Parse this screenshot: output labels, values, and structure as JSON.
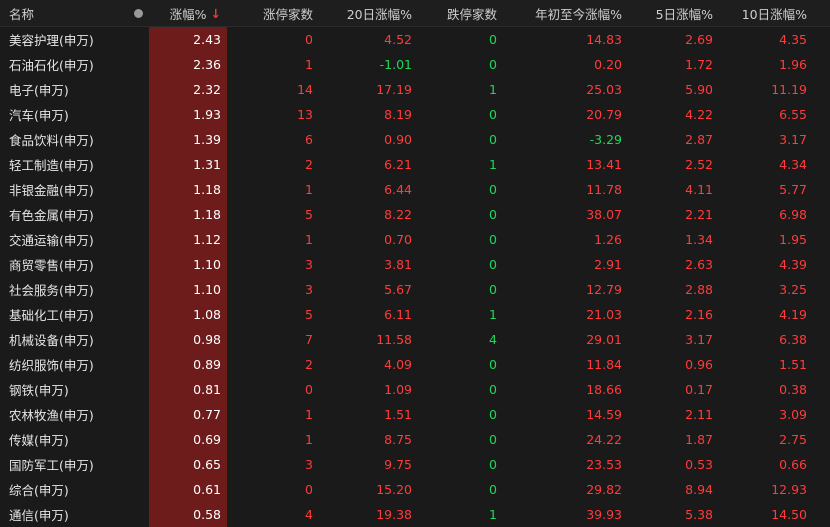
{
  "header": {
    "name": "名称",
    "change": "涨幅%",
    "sort_arrow": "↓",
    "limit_up": "涨停家数",
    "d20": "20日涨幅%",
    "limit_down": "跌停家数",
    "ytd": "年初至今涨幅%",
    "d5": "5日涨幅%",
    "d10": "10日涨幅%"
  },
  "colors": {
    "up": "#ff3b3b",
    "down": "#1ed75a",
    "highlight": "#6e1b1b",
    "background": "#1a1a1a"
  },
  "rows": [
    {
      "name": "美容护理(申万)",
      "change": "2.43",
      "limit_up": "0",
      "d20": "4.52",
      "limit_down": "0",
      "ytd": "14.83",
      "d5": "2.69",
      "d10": "4.35"
    },
    {
      "name": "石油石化(申万)",
      "change": "2.36",
      "limit_up": "1",
      "d20": "-1.01",
      "limit_down": "0",
      "ytd": "0.20",
      "d5": "1.72",
      "d10": "1.96"
    },
    {
      "name": "电子(申万)",
      "change": "2.32",
      "limit_up": "14",
      "d20": "17.19",
      "limit_down": "1",
      "ytd": "25.03",
      "d5": "5.90",
      "d10": "11.19"
    },
    {
      "name": "汽车(申万)",
      "change": "1.93",
      "limit_up": "13",
      "d20": "8.19",
      "limit_down": "0",
      "ytd": "20.79",
      "d5": "4.22",
      "d10": "6.55"
    },
    {
      "name": "食品饮料(申万)",
      "change": "1.39",
      "limit_up": "6",
      "d20": "0.90",
      "limit_down": "0",
      "ytd": "-3.29",
      "d5": "2.87",
      "d10": "3.17"
    },
    {
      "name": "轻工制造(申万)",
      "change": "1.31",
      "limit_up": "2",
      "d20": "6.21",
      "limit_down": "1",
      "ytd": "13.41",
      "d5": "2.52",
      "d10": "4.34"
    },
    {
      "name": "非银金融(申万)",
      "change": "1.18",
      "limit_up": "1",
      "d20": "6.44",
      "limit_down": "0",
      "ytd": "11.78",
      "d5": "4.11",
      "d10": "5.77"
    },
    {
      "name": "有色金属(申万)",
      "change": "1.18",
      "limit_up": "5",
      "d20": "8.22",
      "limit_down": "0",
      "ytd": "38.07",
      "d5": "2.21",
      "d10": "6.98"
    },
    {
      "name": "交通运输(申万)",
      "change": "1.12",
      "limit_up": "1",
      "d20": "0.70",
      "limit_down": "0",
      "ytd": "1.26",
      "d5": "1.34",
      "d10": "1.95"
    },
    {
      "name": "商贸零售(申万)",
      "change": "1.10",
      "limit_up": "3",
      "d20": "3.81",
      "limit_down": "0",
      "ytd": "2.91",
      "d5": "2.63",
      "d10": "4.39"
    },
    {
      "name": "社会服务(申万)",
      "change": "1.10",
      "limit_up": "3",
      "d20": "5.67",
      "limit_down": "0",
      "ytd": "12.79",
      "d5": "2.88",
      "d10": "3.25"
    },
    {
      "name": "基础化工(申万)",
      "change": "1.08",
      "limit_up": "5",
      "d20": "6.11",
      "limit_down": "1",
      "ytd": "21.03",
      "d5": "2.16",
      "d10": "4.19"
    },
    {
      "name": "机械设备(申万)",
      "change": "0.98",
      "limit_up": "7",
      "d20": "11.58",
      "limit_down": "4",
      "ytd": "29.01",
      "d5": "3.17",
      "d10": "6.38"
    },
    {
      "name": "纺织服饰(申万)",
      "change": "0.89",
      "limit_up": "2",
      "d20": "4.09",
      "limit_down": "0",
      "ytd": "11.84",
      "d5": "0.96",
      "d10": "1.51"
    },
    {
      "name": "钢铁(申万)",
      "change": "0.81",
      "limit_up": "0",
      "d20": "1.09",
      "limit_down": "0",
      "ytd": "18.66",
      "d5": "0.17",
      "d10": "0.38"
    },
    {
      "name": "农林牧渔(申万)",
      "change": "0.77",
      "limit_up": "1",
      "d20": "1.51",
      "limit_down": "0",
      "ytd": "14.59",
      "d5": "2.11",
      "d10": "3.09"
    },
    {
      "name": "传媒(申万)",
      "change": "0.69",
      "limit_up": "1",
      "d20": "8.75",
      "limit_down": "0",
      "ytd": "24.22",
      "d5": "1.87",
      "d10": "2.75"
    },
    {
      "name": "国防军工(申万)",
      "change": "0.65",
      "limit_up": "3",
      "d20": "9.75",
      "limit_down": "0",
      "ytd": "23.53",
      "d5": "0.53",
      "d10": "0.66"
    },
    {
      "name": "综合(申万)",
      "change": "0.61",
      "limit_up": "0",
      "d20": "15.20",
      "limit_down": "0",
      "ytd": "29.82",
      "d5": "8.94",
      "d10": "12.93"
    },
    {
      "name": "通信(申万)",
      "change": "0.58",
      "limit_up": "4",
      "d20": "19.38",
      "limit_down": "1",
      "ytd": "39.93",
      "d5": "5.38",
      "d10": "14.50"
    }
  ]
}
